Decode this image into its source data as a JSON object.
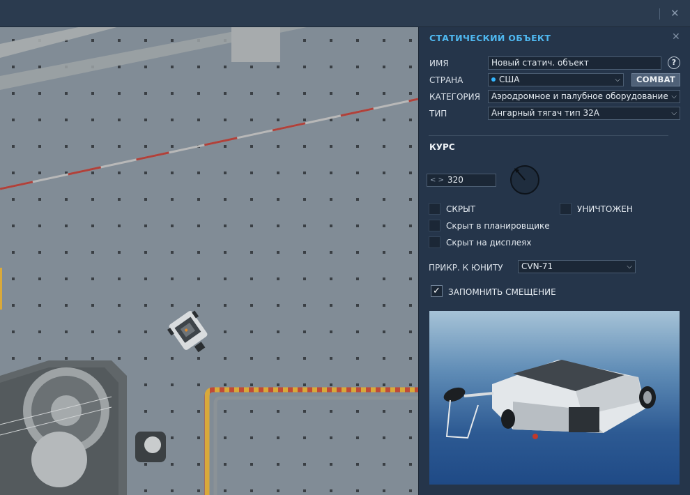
{
  "window": {
    "close_icon": "close-icon"
  },
  "panel": {
    "title": "СТАТИЧЕСКИЙ ОБЪЕКТ",
    "close_icon": "close-icon",
    "name_label": "ИМЯ",
    "name_value": "Новый статич. объект",
    "help_label": "?",
    "country_label": "СТРАНА",
    "country_value": "США",
    "combat_button": "COMBAT",
    "category_label": "КАТЕГОРИЯ",
    "category_value": "Аэродромное и палубное оборудование",
    "type_label": "ТИП",
    "type_value": "Ангарный тягач тип 32А",
    "heading_section": "КУРС",
    "heading_value": "320",
    "hidden_label": "СКРЫТ",
    "destroyed_label": "УНИЧТОЖЕН",
    "hidden_planner_label": "Скрыт в планировщике",
    "hidden_displays_label": "Скрыт на дисплеях",
    "attach_label": "ПРИКР. К ЮНИТУ",
    "attach_value": "CVN-71",
    "remember_offset_label": "ЗАПОМНИТЬ СМЕЩЕНИЕ",
    "remember_offset_checked": true,
    "hidden_checked": false,
    "destroyed_checked": false,
    "hidden_planner_checked": false,
    "hidden_displays_checked": false
  },
  "colors": {
    "accent": "#4fb8f0",
    "country_dot": "#33b6ff",
    "panel_bg": "#25354a"
  }
}
